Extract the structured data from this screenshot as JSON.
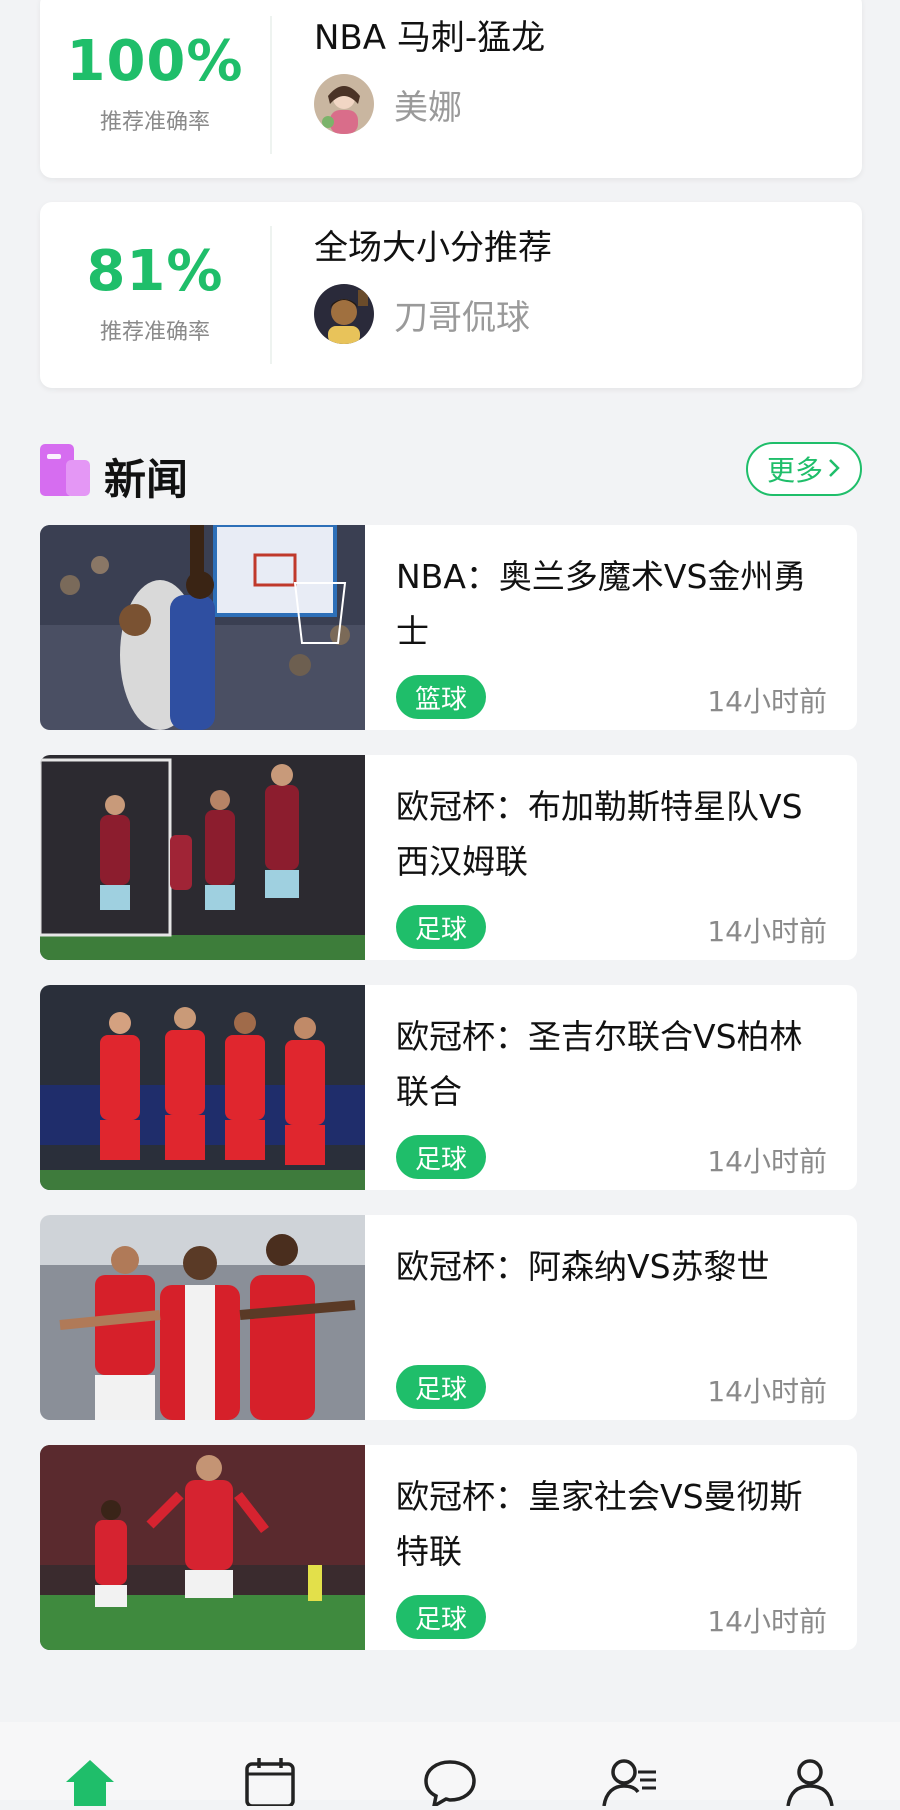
{
  "recommendations": [
    {
      "accuracy": "100%",
      "accuracy_label": "推荐准确率",
      "title": "NBA 马刺-猛龙",
      "author": "美娜"
    },
    {
      "accuracy": "81%",
      "accuracy_label": "推荐准确率",
      "title": "全场大小分推荐",
      "author": "刀哥侃球"
    }
  ],
  "news_section": {
    "title": "新闻",
    "more_label": "更多",
    "more_icon": "chevron-right-icon"
  },
  "news": [
    {
      "title": "NBA：奥兰多魔术VS金州勇士",
      "tag": "篮球",
      "time": "14小时前"
    },
    {
      "title": "欧冠杯：布加勒斯特星队VS西汉姆联",
      "tag": "足球",
      "time": "14小时前"
    },
    {
      "title": "欧冠杯：圣吉尔联合VS柏林联合",
      "tag": "足球",
      "time": "14小时前"
    },
    {
      "title": "欧冠杯：阿森纳VS苏黎世",
      "tag": "足球",
      "time": "14小时前"
    },
    {
      "title": "欧冠杯：皇家社会VS曼彻斯特联",
      "tag": "足球",
      "time": "14小时前"
    }
  ],
  "tabbar": {
    "icons": [
      "home-icon",
      "calendar-icon",
      "chat-icon",
      "expert-icon",
      "user-icon"
    ],
    "active_color": "#1fbe6a"
  },
  "colors": {
    "accent": "#1fbe6a",
    "background": "#f2f3f5"
  }
}
